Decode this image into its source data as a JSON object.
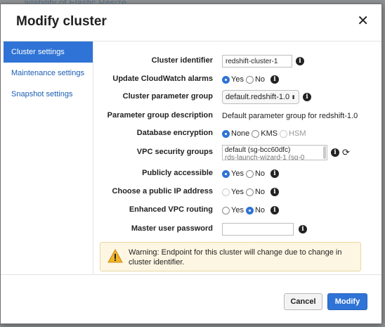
{
  "background": {
    "link_text": "ailability of Elastic Resize"
  },
  "modal": {
    "title": "Modify cluster",
    "close_icon": "close-icon"
  },
  "sidebar": {
    "items": [
      {
        "label": "Cluster settings",
        "active": true
      },
      {
        "label": "Maintenance settings",
        "active": false
      },
      {
        "label": "Snapshot settings",
        "active": false
      }
    ]
  },
  "form": {
    "cluster_identifier": {
      "label": "Cluster identifier",
      "value": "redshift-cluster-1"
    },
    "cloudwatch_alarms": {
      "label": "Update CloudWatch alarms",
      "options": [
        "Yes",
        "No"
      ],
      "selected": "Yes"
    },
    "parameter_group": {
      "label": "Cluster parameter group",
      "value": "default.redshift-1.0"
    },
    "parameter_group_description": {
      "label": "Parameter group description",
      "value": "Default parameter group for redshift-1.0"
    },
    "database_encryption": {
      "label": "Database encryption",
      "options": [
        "None",
        "KMS",
        "HSM"
      ],
      "selected": "None"
    },
    "vpc_security_groups": {
      "label": "VPC security groups",
      "line1": "default (sg-bcc60dfc)",
      "line2": "rds-launch-wizard-1 (sg-0"
    },
    "publicly_accessible": {
      "label": "Publicly accessible",
      "options": [
        "Yes",
        "No"
      ],
      "selected": "Yes"
    },
    "public_ip": {
      "label": "Choose a public IP address",
      "options": [
        "Yes",
        "No"
      ],
      "selected": "No"
    },
    "enhanced_vpc_routing": {
      "label": "Enhanced VPC routing",
      "options": [
        "Yes",
        "No"
      ],
      "selected": "No"
    },
    "master_password": {
      "label": "Master user password",
      "value": ""
    }
  },
  "warning": {
    "text": "Warning: Endpoint for this cluster will change due to change in cluster identifier."
  },
  "buttons": {
    "cancel": "Cancel",
    "modify": "Modify"
  },
  "colors": {
    "accent": "#2f73d6",
    "warning_bg": "#fdf6e3",
    "warning_icon": "#f0b429"
  }
}
